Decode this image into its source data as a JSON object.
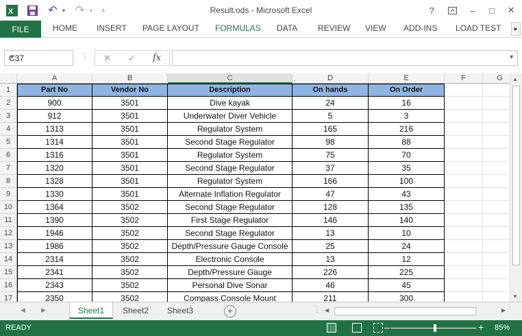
{
  "window": {
    "title": "Result.ods - Microsoft Excel",
    "help": "?",
    "minimize": "–",
    "maximize": "□",
    "close": "✕"
  },
  "quick_access": {
    "app_icon": "excel-icon",
    "save_icon": "save-icon",
    "undo_icon": "undo-icon",
    "redo_icon": "redo-icon",
    "customize_icon": "customize-icon"
  },
  "ribbon": {
    "tabs": [
      "FILE",
      "HOME",
      "INSERT",
      "PAGE LAYOUT",
      "FORMULAS",
      "DATA",
      "REVIEW",
      "VIEW",
      "ADD-INS",
      "LOAD TEST"
    ],
    "active": "FORMULAS",
    "scroll_glyph": "▸"
  },
  "formula_bar": {
    "name_box": "C37",
    "cancel": "✕",
    "enter": "✓",
    "fx": "fx",
    "value": ""
  },
  "grid": {
    "columns": [
      "A",
      "B",
      "C",
      "D",
      "E",
      "F",
      "G"
    ],
    "selected_column": "C",
    "headers": [
      "Part No",
      "Vendor No",
      "Description",
      "On hands",
      "On Order"
    ],
    "rows": [
      [
        "900",
        "3501",
        "Dive kayak",
        "24",
        "16"
      ],
      [
        "912",
        "3501",
        "Underwater Diver Vehicle",
        "5",
        "3"
      ],
      [
        "1313",
        "3501",
        "Regulator System",
        "165",
        "216"
      ],
      [
        "1314",
        "3501",
        "Second Stage Regulator",
        "98",
        "88"
      ],
      [
        "1316",
        "3501",
        "Regulator System",
        "75",
        "70"
      ],
      [
        "1320",
        "3501",
        "Second Stage Regulator",
        "37",
        "35"
      ],
      [
        "1328",
        "3501",
        "Regulator System",
        "166",
        "100"
      ],
      [
        "1330",
        "3501",
        "Alternate Inflation Regulator",
        "47",
        "43"
      ],
      [
        "1364",
        "3502",
        "Second Stage Regulator",
        "128",
        "135"
      ],
      [
        "1390",
        "3502",
        "First Stage Regulator",
        "146",
        "140"
      ],
      [
        "1946",
        "3502",
        "Second Stage Regulator",
        "13",
        "10"
      ],
      [
        "1986",
        "3502",
        "Depth/Pressure Gauge Console",
        "25",
        "24"
      ],
      [
        "2314",
        "3502",
        "Electronic Console",
        "13",
        "12"
      ],
      [
        "2341",
        "3502",
        "Depth/Pressure Gauge",
        "226",
        "225"
      ],
      [
        "2343",
        "3502",
        "Personal Dive Sonar",
        "46",
        "45"
      ],
      [
        "2350",
        "3502",
        "Compass Console Mount",
        "211",
        "300"
      ]
    ],
    "header_color": "#8db4e2"
  },
  "sheets": {
    "tabs": [
      "Sheet1",
      "Sheet2",
      "Sheet3"
    ],
    "active": "Sheet1",
    "add": "⊕"
  },
  "status": {
    "ready": "READY",
    "zoom": "85%",
    "zoom_level": 0.5,
    "minus": "–",
    "plus": "+"
  },
  "colors": {
    "accent": "#217346"
  }
}
